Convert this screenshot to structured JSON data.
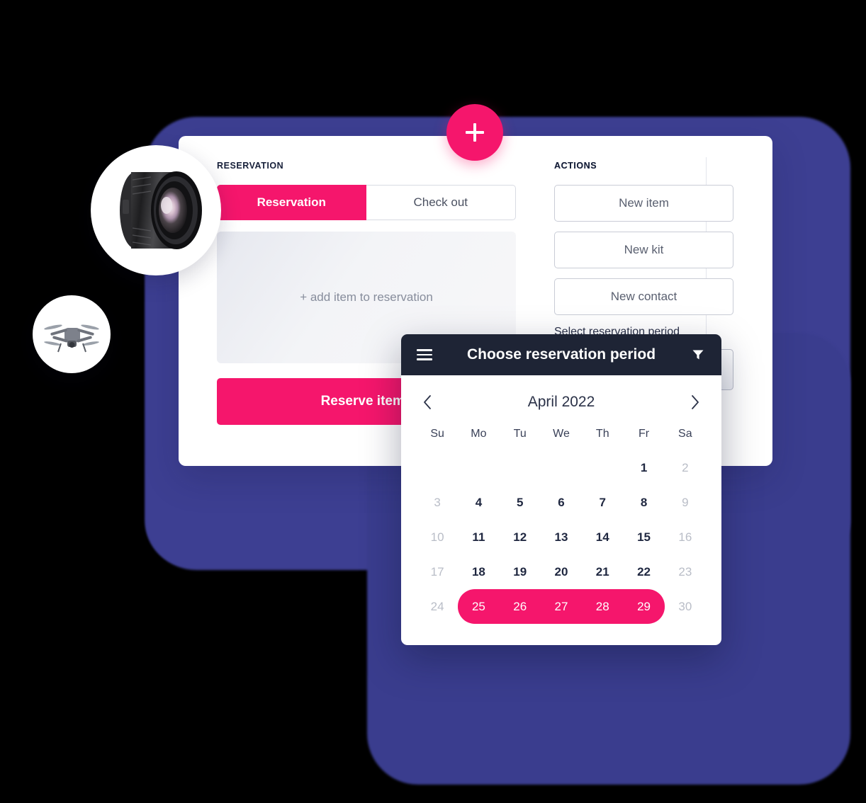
{
  "card": {
    "reservation_label": "RESERVATION",
    "actions_label": "ACTIONS",
    "tabs": [
      {
        "label": "Reservation",
        "active": true
      },
      {
        "label": "Check out",
        "active": false
      }
    ],
    "drop_zone_text": "+ add item to reservation",
    "reserve_button_label": "Reserve items",
    "actions": [
      {
        "label": "New item"
      },
      {
        "label": "New kit"
      },
      {
        "label": "New contact"
      }
    ],
    "period_field_label": "Select reservation period",
    "period_field_value": ""
  },
  "fab": {
    "icon": "plus-icon",
    "color": "#f5166c"
  },
  "thumbnails": [
    {
      "name": "camera-lens-thumbnail"
    },
    {
      "name": "drone-thumbnail"
    }
  ],
  "calendar": {
    "title": "Choose reservation period",
    "menu_icon": "hamburger-icon",
    "filter_icon": "funnel-icon",
    "prev_icon": "chevron-left-icon",
    "next_icon": "chevron-right-icon",
    "month_label": "April 2022",
    "weekdays": [
      "Su",
      "Mo",
      "Tu",
      "We",
      "Th",
      "Fr",
      "Sa"
    ],
    "weeks": [
      [
        {
          "day": "",
          "type": "empty"
        },
        {
          "day": "",
          "type": "empty"
        },
        {
          "day": "",
          "type": "empty"
        },
        {
          "day": "",
          "type": "empty"
        },
        {
          "day": "",
          "type": "empty"
        },
        {
          "day": "1",
          "type": "day"
        },
        {
          "day": "2",
          "type": "weekend"
        }
      ],
      [
        {
          "day": "3",
          "type": "weekend"
        },
        {
          "day": "4",
          "type": "day"
        },
        {
          "day": "5",
          "type": "day"
        },
        {
          "day": "6",
          "type": "day"
        },
        {
          "day": "7",
          "type": "day"
        },
        {
          "day": "8",
          "type": "day"
        },
        {
          "day": "9",
          "type": "weekend"
        }
      ],
      [
        {
          "day": "10",
          "type": "weekend"
        },
        {
          "day": "11",
          "type": "day"
        },
        {
          "day": "12",
          "type": "day"
        },
        {
          "day": "13",
          "type": "day"
        },
        {
          "day": "14",
          "type": "day"
        },
        {
          "day": "15",
          "type": "day"
        },
        {
          "day": "16",
          "type": "weekend"
        }
      ],
      [
        {
          "day": "17",
          "type": "weekend"
        },
        {
          "day": "18",
          "type": "day"
        },
        {
          "day": "19",
          "type": "day"
        },
        {
          "day": "20",
          "type": "day"
        },
        {
          "day": "21",
          "type": "day"
        },
        {
          "day": "22",
          "type": "day"
        },
        {
          "day": "23",
          "type": "weekend"
        }
      ],
      [
        {
          "day": "24",
          "type": "weekend"
        },
        {
          "day": "25",
          "type": "selected-start"
        },
        {
          "day": "26",
          "type": "selected"
        },
        {
          "day": "27",
          "type": "selected"
        },
        {
          "day": "28",
          "type": "selected"
        },
        {
          "day": "29",
          "type": "selected-end"
        },
        {
          "day": "30",
          "type": "weekend"
        }
      ]
    ],
    "selected_range": {
      "start": "25",
      "end": "29",
      "month": "April 2022"
    }
  },
  "colors": {
    "accent_pink": "#f5166c",
    "dark_navy": "#1e2435",
    "background_purple": "#3d3f92",
    "muted_text": "#878d9c"
  }
}
